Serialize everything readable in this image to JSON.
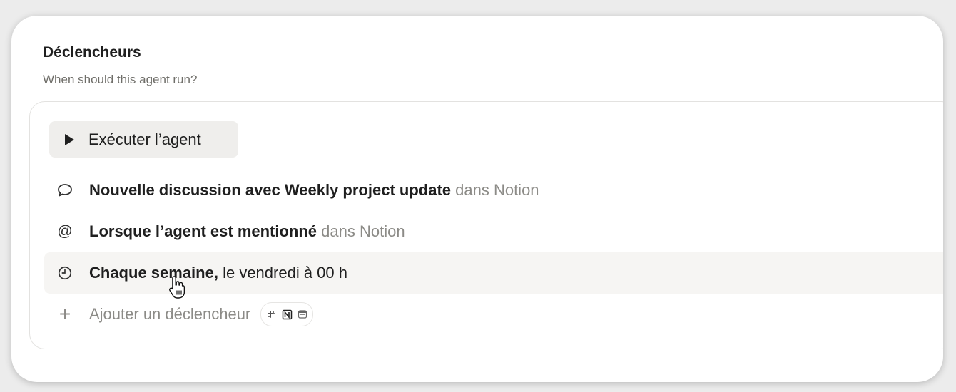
{
  "section": {
    "title": "Déclencheurs",
    "subtitle": "When should this agent run?"
  },
  "run_button": {
    "label": "Exécuter l’agent",
    "icon": "play-icon"
  },
  "triggers": [
    {
      "icon": "chat-bubble-icon",
      "bold": "Nouvelle discussion avec Weekly project update",
      "rest": "",
      "muted": "dans Notion"
    },
    {
      "icon": "at-sign-icon",
      "bold": "Lorsque l’agent est mentionné",
      "rest": "",
      "muted": "dans Notion"
    },
    {
      "icon": "clock-icon",
      "bold": "Chaque semaine,",
      "rest": "le vendredi à 00 h",
      "muted": ""
    }
  ],
  "add_trigger": {
    "label": "Ajouter un déclencheur",
    "icon": "plus-icon",
    "apps": [
      "slack-icon",
      "notion-icon",
      "calendar-icon"
    ]
  },
  "colors": {
    "background": "#ececec",
    "card": "#ffffff",
    "muted_text": "#8c8b87",
    "button_bg": "#efeeec",
    "hover_row": "#f6f5f3"
  }
}
